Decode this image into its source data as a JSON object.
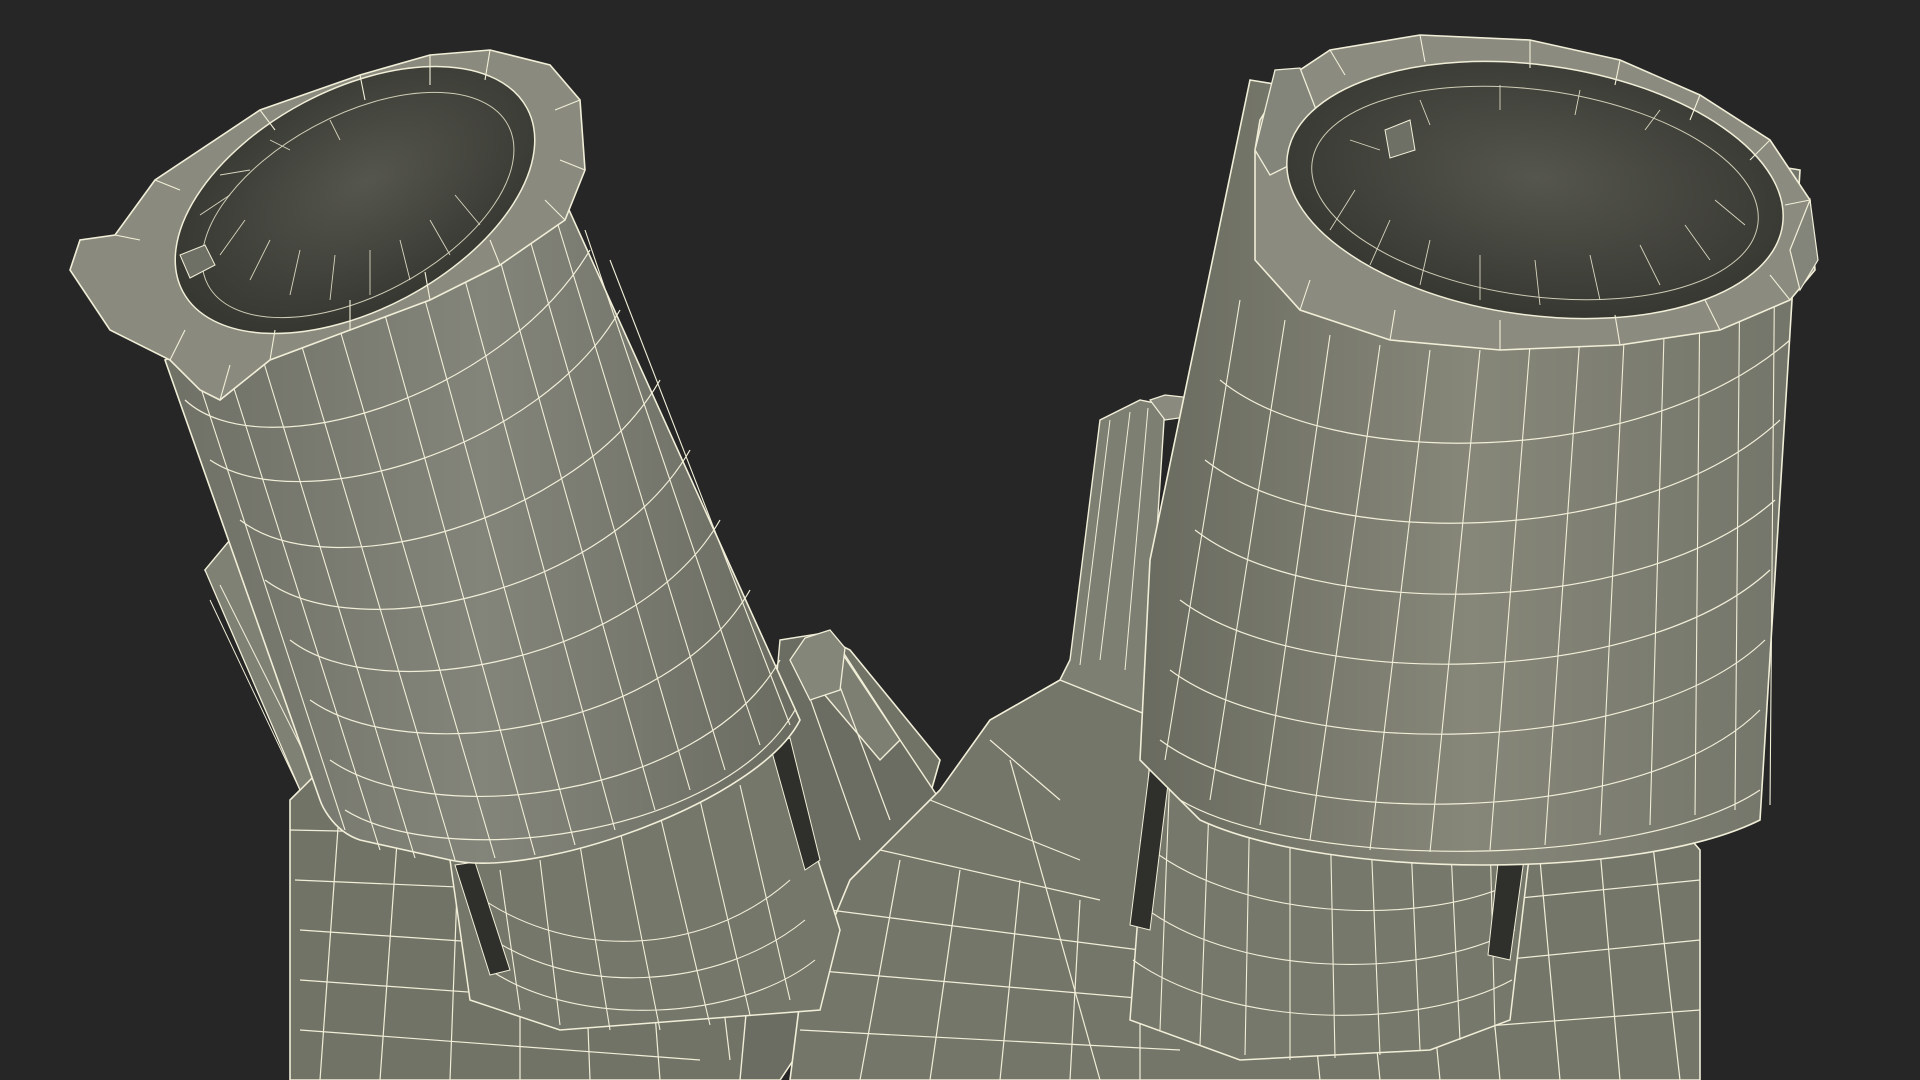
{
  "viewport": {
    "background_color": "#262626"
  },
  "model": {
    "surface_color": "#7b7c6f",
    "surface_shadow_color": "#5d5e53",
    "surface_highlight_color": "#8f9082",
    "interior_color": "#3a3b35",
    "wire_color": "#f4f1dc",
    "render_mode": "wireframe-on-shaded"
  }
}
